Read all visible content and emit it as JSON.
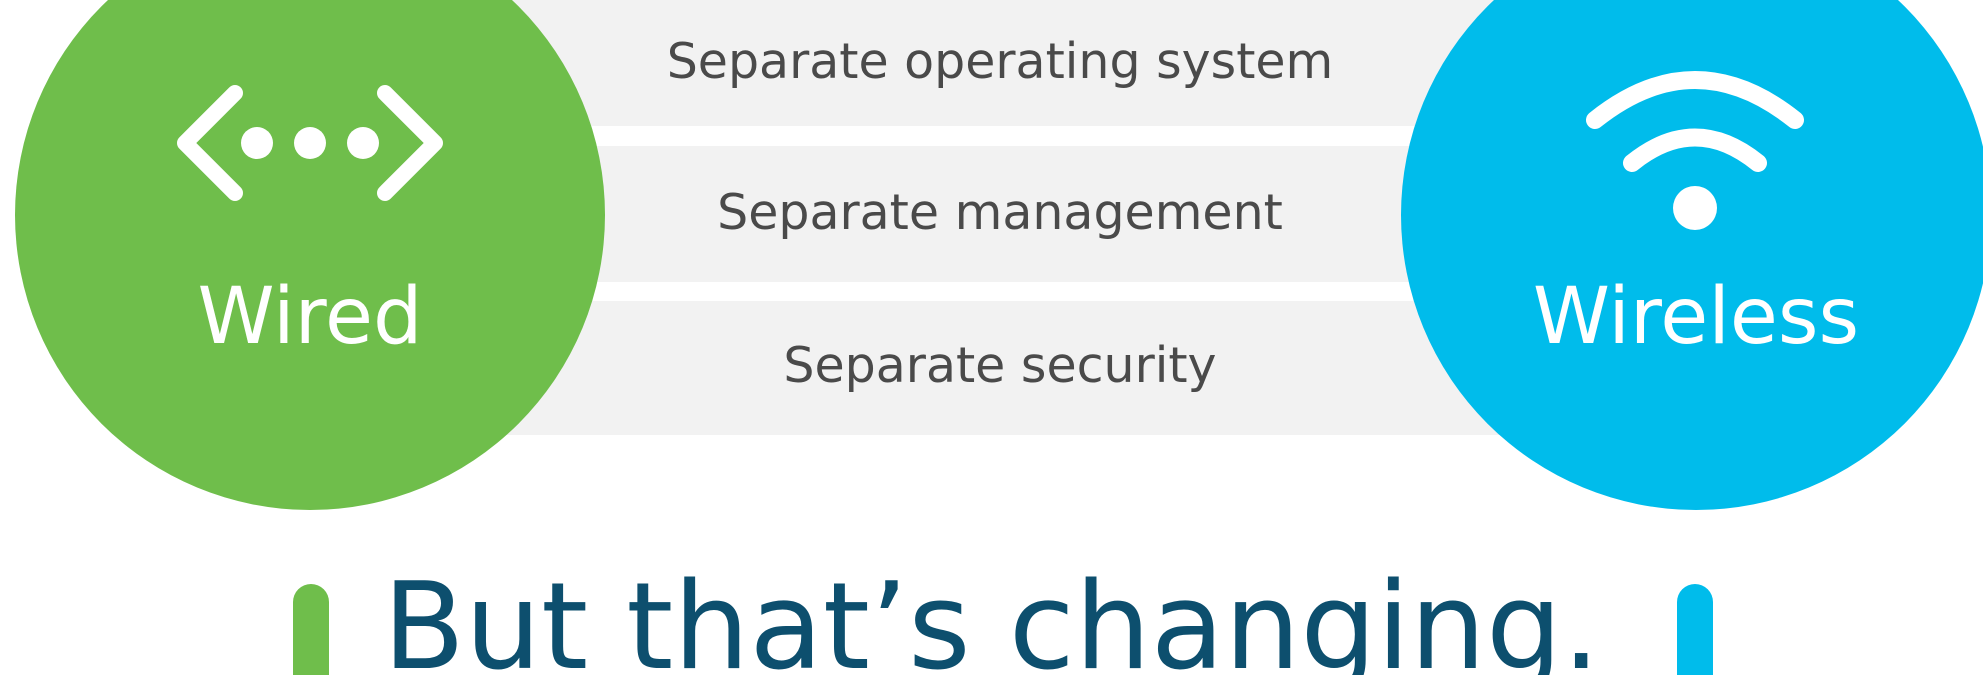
{
  "colors": {
    "wired": "#6fbe4b",
    "wireless": "#00bceb",
    "band": "#f2f2f2",
    "band_text": "#4a4a4a",
    "headline": "#0d4f6e"
  },
  "bands": [
    {
      "label": "Separate operating system"
    },
    {
      "label": "Separate management"
    },
    {
      "label": "Separate security"
    }
  ],
  "wired": {
    "label": "Wired",
    "icon": "network-dots-icon"
  },
  "wireless": {
    "label": "Wireless",
    "icon": "wifi-icon"
  },
  "headline": "But that’s changing."
}
